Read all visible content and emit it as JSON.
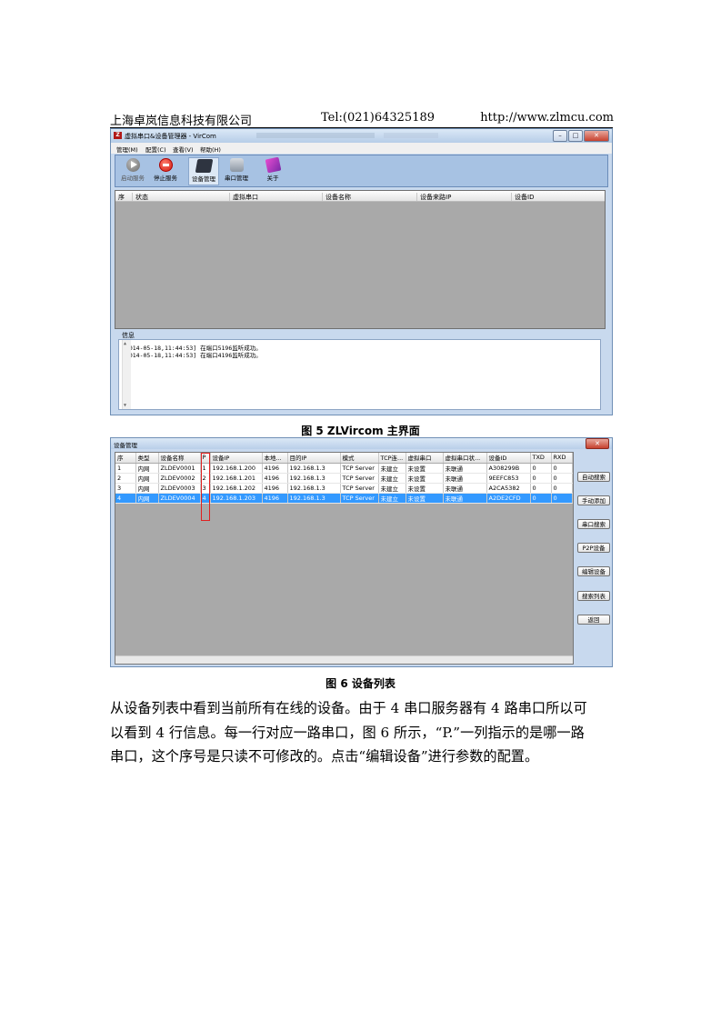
{
  "header": {
    "company": "上海卓岚信息科技有限公司",
    "tel": "Tel:(021)64325189",
    "url": "http://www.zlmcu.com"
  },
  "window1": {
    "title": "虚拟串口&设备管理器 - VirCom",
    "icon_text": "Z",
    "menu": [
      "管理(M)",
      "配置(C)",
      "查看(V)",
      "帮助(H)"
    ],
    "toolbar": [
      {
        "label": "启动服务",
        "icon": "start-icon"
      },
      {
        "label": "停止服务",
        "icon": "stop-icon"
      },
      {
        "label": "设备管理",
        "icon": "device-icon"
      },
      {
        "label": "串口管理",
        "icon": "serial-icon"
      },
      {
        "label": "关于",
        "icon": "about-icon"
      }
    ],
    "columns": [
      "序",
      "状态",
      "虚拟串口",
      "设备名称",
      "设备来路IP",
      "设备ID"
    ],
    "info_label": "信息",
    "log": [
      "[2014-05-18,11:44:53] 在端口5196监听成功。",
      "[2014-05-18,11:44:53] 在端口4196监听成功。"
    ]
  },
  "caption1": "图 5 ZLVircom 主界面",
  "window2": {
    "title": "设备管理",
    "columns": [
      "序",
      "类型",
      "设备名称",
      "P",
      "设备IP",
      "本地...",
      "目的IP",
      "模式",
      "TCP连...",
      "虚拟串口",
      "虚拟串口状...",
      "设备ID",
      "TXD",
      "RXD"
    ],
    "rows": [
      [
        "1",
        "内网",
        "ZLDEV0001",
        "1",
        "192.168.1.200",
        "4196",
        "192.168.1.3",
        "TCP Server",
        "未建立",
        "未设置",
        "未联通",
        "A308299B",
        "0",
        "0"
      ],
      [
        "2",
        "内网",
        "ZLDEV0002",
        "2",
        "192.168.1.201",
        "4196",
        "192.168.1.3",
        "TCP Server",
        "未建立",
        "未设置",
        "未联通",
        "9EEFC853",
        "0",
        "0"
      ],
      [
        "3",
        "内网",
        "ZLDEV0003",
        "3",
        "192.168.1.202",
        "4196",
        "192.168.1.3",
        "TCP Server",
        "未建立",
        "未设置",
        "未联通",
        "A2CA5382",
        "0",
        "0"
      ],
      [
        "4",
        "内网",
        "ZLDEV0004",
        "4",
        "192.168.1.203",
        "4196",
        "192.168.1.3",
        "TCP Server",
        "未建立",
        "未设置",
        "未联通",
        "A2DE2CFD",
        "0",
        "0"
      ]
    ],
    "selected_row": 4,
    "buttons": [
      "自动搜索",
      "手动添加",
      "串口搜索",
      "P2P设备",
      "编辑设备",
      "搜索列表",
      "返回"
    ]
  },
  "caption2": "图 6 设备列表",
  "paragraph": [
    "从设备列表中看到当前所有在线的设备。由于 4 串口服务器有 4 路串口所以可",
    "以看到 4 行信息。每一行对应一路串口，图 6 所示，“P.”一列指示的是哪一路",
    "串口，这个序号是只读不可修改的。点击“编辑设备”进行参数的配置。"
  ]
}
